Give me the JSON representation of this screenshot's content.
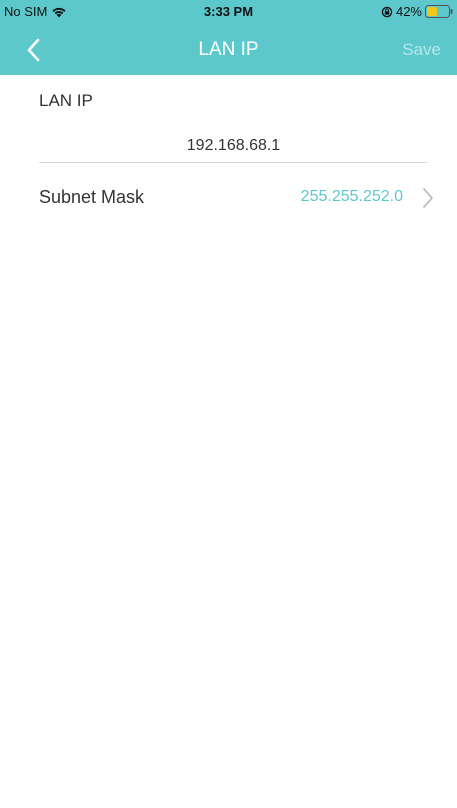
{
  "status_bar": {
    "carrier": "No SIM",
    "time": "3:33 PM",
    "battery": "42%"
  },
  "nav": {
    "title": "LAN IP",
    "save_label": "Save"
  },
  "form": {
    "lan_ip_label": "LAN IP",
    "lan_ip_value": "192.168.68.1",
    "subnet_label": "Subnet Mask",
    "subnet_value": "255.255.252.0"
  },
  "colors": {
    "accent": "#5cc8cc",
    "battery_fill": "#f5c518"
  },
  "icons": [
    "wifi-icon",
    "lock-rotation-icon",
    "battery-icon",
    "back-chevron-icon",
    "chevron-right-icon"
  ]
}
